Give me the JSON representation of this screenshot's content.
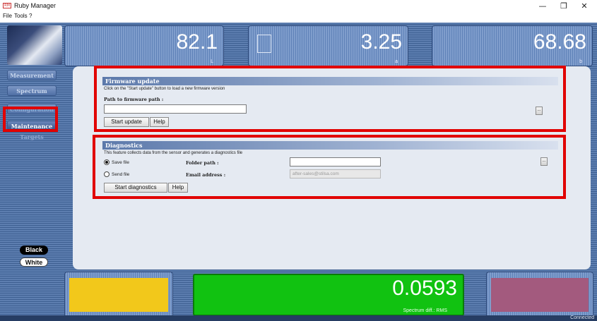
{
  "window": {
    "title": "Ruby Manager",
    "icon_text": "RM",
    "minimize": "—",
    "maximize": "❐",
    "close": "✕"
  },
  "menu": [
    "File",
    "Tools",
    "?"
  ],
  "top_panels": [
    {
      "value": "82.1",
      "sub": "L"
    },
    {
      "value": "3.25",
      "sub": "a"
    },
    {
      "value": "68.68",
      "sub": "b"
    }
  ],
  "nav": {
    "items": [
      "Measurement",
      "Spectrum",
      "Configuration",
      "Maintenance",
      "Targets"
    ],
    "active": "Maintenance"
  },
  "theme_buttons": {
    "black": "Black",
    "white": "White"
  },
  "firmware": {
    "title": "Firmware update",
    "description": "Click on the \"Start update\" button to load a new firmware version",
    "path_label": "Path to firmware path :",
    "path_value": "",
    "start_button": "Start update",
    "help_button": "Help",
    "browse": "..."
  },
  "diagnostics": {
    "title": "Diagnostics",
    "description": "This feature collects data from the sensor and generates a diagnostics file",
    "save_file": "Save file",
    "send_file": "Send file",
    "selected": "Save file",
    "folder_label": "Folder path :",
    "folder_value": "",
    "email_label": "Email address :",
    "email_value": "after-sales@stilsa.com",
    "start_button": "Start diagnostics",
    "help_button": "Help",
    "browse": "..."
  },
  "bottom": {
    "left_color": "#f2c81b",
    "right_color": "#a35a7e",
    "value": "0.0593",
    "label": "Spectrum diff.: RMS"
  },
  "status": "Connected"
}
